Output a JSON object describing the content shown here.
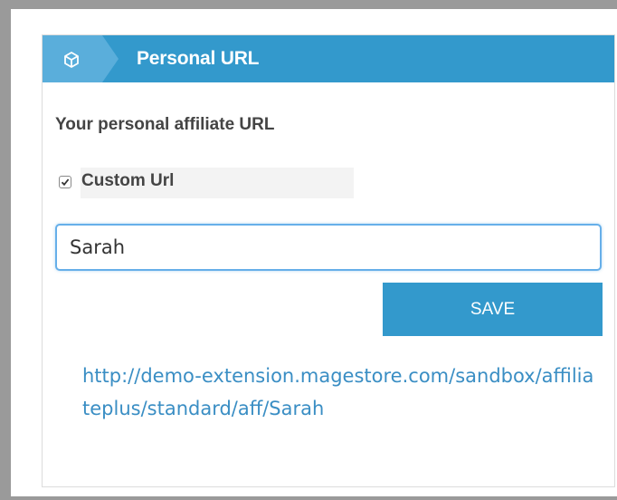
{
  "panel": {
    "title": "Personal URL",
    "header_icon": "cube-icon",
    "accent_color": "#3399cc"
  },
  "form": {
    "subtitle": "Your personal affiliate URL",
    "custom_url": {
      "label": "Custom Url",
      "checked": true
    },
    "input_value": "Sarah",
    "save_label": "SAVE"
  },
  "affiliate_url": "http://demo-extension.magestore.com/sandbox/affiliateplus/standard/aff/Sarah"
}
